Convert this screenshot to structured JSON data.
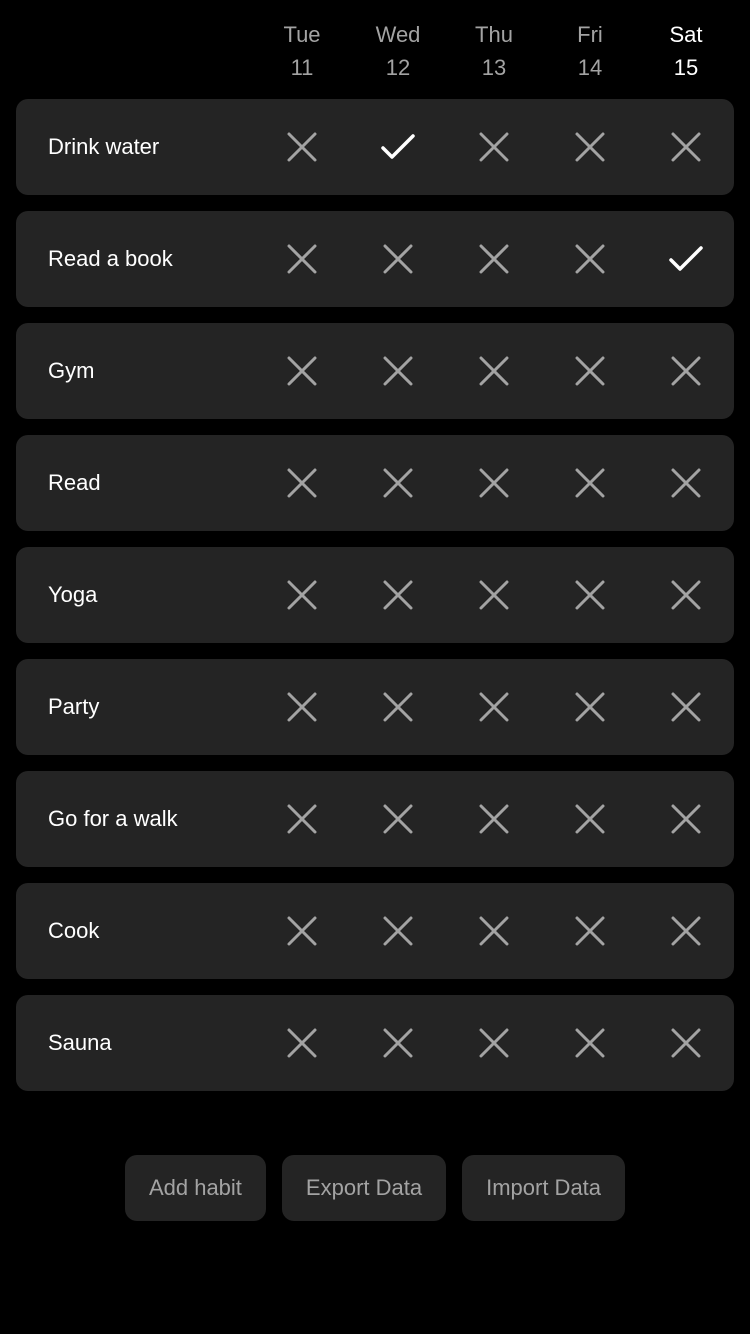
{
  "days": [
    {
      "weekday": "Tue",
      "date": "11",
      "today": false
    },
    {
      "weekday": "Wed",
      "date": "12",
      "today": false
    },
    {
      "weekday": "Thu",
      "date": "13",
      "today": false
    },
    {
      "weekday": "Fri",
      "date": "14",
      "today": false
    },
    {
      "weekday": "Sat",
      "date": "15",
      "today": true
    }
  ],
  "habits": [
    {
      "name": "Drink water",
      "done": [
        false,
        true,
        false,
        false,
        false
      ]
    },
    {
      "name": "Read a book",
      "done": [
        false,
        false,
        false,
        false,
        true
      ]
    },
    {
      "name": "Gym",
      "done": [
        false,
        false,
        false,
        false,
        false
      ]
    },
    {
      "name": "Read",
      "done": [
        false,
        false,
        false,
        false,
        false
      ]
    },
    {
      "name": "Yoga",
      "done": [
        false,
        false,
        false,
        false,
        false
      ]
    },
    {
      "name": "Party",
      "done": [
        false,
        false,
        false,
        false,
        false
      ]
    },
    {
      "name": "Go for a walk",
      "done": [
        false,
        false,
        false,
        false,
        false
      ]
    },
    {
      "name": "Cook",
      "done": [
        false,
        false,
        false,
        false,
        false
      ]
    },
    {
      "name": "Sauna",
      "done": [
        false,
        false,
        false,
        false,
        false
      ]
    }
  ],
  "actions": {
    "add_label": "Add habit",
    "export_label": "Export Data",
    "import_label": "Import Data"
  },
  "icons": {
    "done": "check-icon",
    "not_done": "x-icon"
  },
  "colors": {
    "background": "#000000",
    "card": "#242424",
    "muted": "#a3a3a3",
    "text": "#ffffff"
  }
}
